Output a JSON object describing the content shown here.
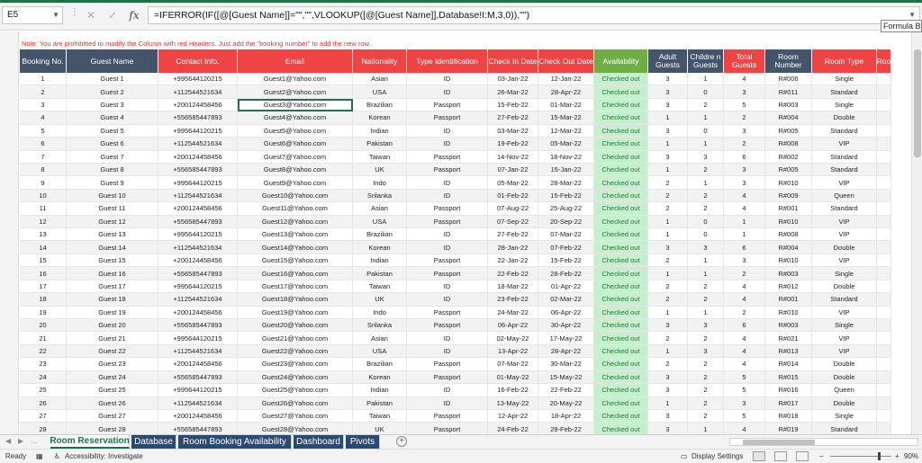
{
  "formula_bar": {
    "name_box": "E5",
    "formula": "=IFERROR(IF([@[Guest Name]]=\"\",\"\",VLOOKUP([@[Guest Name]],Database!I:M,3,0)),\"\")",
    "tooltip": "Formula Bar"
  },
  "note": "Note: You are prohibitted to modify the Column with red Headers. Just add the \"booking number\" to add the new row.",
  "table": {
    "columns": [
      {
        "label": "Booking No.",
        "style": "dark"
      },
      {
        "label": "Guest Name",
        "style": "dark"
      },
      {
        "label": "Contact Info.",
        "style": "red"
      },
      {
        "label": "Email",
        "style": "red"
      },
      {
        "label": "Nationality",
        "style": "red"
      },
      {
        "label": "Type Identification",
        "style": "red"
      },
      {
        "label": "Check In Date",
        "style": "red"
      },
      {
        "label": "Check Out Date",
        "style": "red"
      },
      {
        "label": "Availability",
        "style": "green"
      },
      {
        "label": "Adult Guests",
        "style": "dark"
      },
      {
        "label": "Childre n Guests",
        "style": "dark"
      },
      {
        "label": "Total Guests",
        "style": "red"
      },
      {
        "label": "Room Number",
        "style": "dark"
      },
      {
        "label": "Room Type",
        "style": "red"
      },
      {
        "label": "Roo",
        "style": "red"
      }
    ],
    "rows": [
      [
        "1",
        "Guest 1",
        "+995644120215",
        "Guest1@Yahoo.com",
        "Asian",
        "ID",
        "03-Jan-22",
        "12-Jan-22",
        "Checked out",
        "3",
        "1",
        "4",
        "R#006",
        "Single"
      ],
      [
        "2",
        "Guest 2",
        "+112544521634",
        "Guest2@Yahoo.com",
        "USA",
        "ID",
        "26-Mar-22",
        "28-Apr-22",
        "Checked out",
        "3",
        "0",
        "3",
        "R#011",
        "Standard"
      ],
      [
        "3",
        "Guest 3",
        "+200124458456",
        "Guest3@Yahoo.com",
        "Brazilian",
        "Passport",
        "15-Feb-22",
        "01-Mar-22",
        "Checked out",
        "3",
        "2",
        "5",
        "R#003",
        "Single"
      ],
      [
        "4",
        "Guest 4",
        "+556585447893",
        "Guest4@Yahoo.com",
        "Korean",
        "Passport",
        "27-Feb-22",
        "15-Mar-22",
        "Checked out",
        "1",
        "1",
        "2",
        "R#004",
        "Double"
      ],
      [
        "5",
        "Guest 5",
        "+995644120215",
        "Guest5@Yahoo.com",
        "Indian",
        "ID",
        "03-Mar-22",
        "12-Mar-22",
        "Checked out",
        "3",
        "0",
        "3",
        "R#005",
        "Standard"
      ],
      [
        "6",
        "Guest 6",
        "+112544521634",
        "Guest6@Yahoo.com",
        "Pakistan",
        "ID",
        "19-Feb-22",
        "05-Mar-22",
        "Checked out",
        "1",
        "1",
        "2",
        "R#008",
        "VIP"
      ],
      [
        "7",
        "Guest 7",
        "+200124458456",
        "Guest7@Yahoo.com",
        "Taiwan",
        "Passport",
        "14-Nov-22",
        "18-Nov-22",
        "Checked out",
        "3",
        "3",
        "6",
        "R#002",
        "Standard"
      ],
      [
        "8",
        "Guest 8",
        "+556585447893",
        "Guest8@Yahoo.com",
        "UK",
        "Passport",
        "07-Jan-22",
        "15-Jan-22",
        "Checked out",
        "1",
        "2",
        "3",
        "R#005",
        "Standard"
      ],
      [
        "9",
        "Guest 9",
        "+995644120215",
        "Guest9@Yahoo.com",
        "Indo",
        "ID",
        "05-Mar-22",
        "28-Mar-22",
        "Checked out",
        "2",
        "1",
        "3",
        "R#010",
        "VIP"
      ],
      [
        "10",
        "Guest 10",
        "+112544521634",
        "Guest10@Yahoo.com",
        "Srilanka",
        "ID",
        "01-Feb-22",
        "15-Feb-22",
        "Checked out",
        "2",
        "2",
        "4",
        "R#009",
        "Queen"
      ],
      [
        "11",
        "Guest 11",
        "+200124458456",
        "Guest11@Yahoo.com",
        "Asian",
        "Passport",
        "07-Aug-22",
        "25-Aug-22",
        "Checked out",
        "2",
        "2",
        "4",
        "R#001",
        "Standard"
      ],
      [
        "12",
        "Guest 12",
        "+556585447893",
        "Guest12@Yahoo.com",
        "USA",
        "Passport",
        "07-Sep-22",
        "20-Sep-22",
        "Checked out",
        "1",
        "0",
        "1",
        "R#010",
        "VIP"
      ],
      [
        "13",
        "Guest 13",
        "+995644120215",
        "Guest13@Yahoo.com",
        "Brazilian",
        "ID",
        "27-Feb-22",
        "07-Mar-22",
        "Checked out",
        "1",
        "0",
        "1",
        "R#008",
        "VIP"
      ],
      [
        "14",
        "Guest 14",
        "+112544521634",
        "Guest14@Yahoo.com",
        "Korean",
        "ID",
        "28-Jan-22",
        "07-Feb-22",
        "Checked out",
        "3",
        "3",
        "6",
        "R#004",
        "Double"
      ],
      [
        "15",
        "Guest 15",
        "+200124458456",
        "Guest15@Yahoo.com",
        "Indian",
        "Passport",
        "22-Jan-22",
        "15-Feb-22",
        "Checked out",
        "2",
        "1",
        "3",
        "R#010",
        "VIP"
      ],
      [
        "16",
        "Guest 16",
        "+556585447893",
        "Guest16@Yahoo.com",
        "Pakistan",
        "Passport",
        "22-Feb-22",
        "28-Feb-22",
        "Checked out",
        "1",
        "1",
        "2",
        "R#003",
        "Single"
      ],
      [
        "17",
        "Guest 17",
        "+995644120215",
        "Guest17@Yahoo.com",
        "Taiwan",
        "ID",
        "18-Mar-22",
        "01-Apr-22",
        "Checked out",
        "2",
        "2",
        "4",
        "R#012",
        "Double"
      ],
      [
        "18",
        "Guest 18",
        "+112544521634",
        "Guest18@Yahoo.com",
        "UK",
        "ID",
        "23-Feb-22",
        "02-Mar-22",
        "Checked out",
        "2",
        "2",
        "4",
        "R#001",
        "Standard"
      ],
      [
        "19",
        "Guest 19",
        "+200124458456",
        "Guest19@Yahoo.com",
        "Indo",
        "Passport",
        "24-Mar-22",
        "06-Apr-22",
        "Checked out",
        "1",
        "1",
        "2",
        "R#010",
        "VIP"
      ],
      [
        "20",
        "Guest 20",
        "+556585447893",
        "Guest20@Yahoo.com",
        "Srilanka",
        "Passport",
        "06-Apr-22",
        "30-Apr-22",
        "Checked out",
        "3",
        "3",
        "6",
        "R#003",
        "Single"
      ],
      [
        "21",
        "Guest 21",
        "+995644120215",
        "Guest21@Yahoo.com",
        "Asian",
        "ID",
        "02-May-22",
        "17-May-22",
        "Checked out",
        "2",
        "2",
        "4",
        "R#021",
        "VIP"
      ],
      [
        "22",
        "Guest 22",
        "+112544521634",
        "Guest22@Yahoo.com",
        "USA",
        "ID",
        "13-Apr-22",
        "28-Apr-22",
        "Checked out",
        "1",
        "3",
        "4",
        "R#013",
        "VIP"
      ],
      [
        "23",
        "Guest 23",
        "+200124458456",
        "Guest23@Yahoo.com",
        "Brazilian",
        "Passport",
        "07-Mar-22",
        "30-Mar-22",
        "Checked out",
        "2",
        "2",
        "4",
        "R#014",
        "Double"
      ],
      [
        "24",
        "Guest 24",
        "+556585447893",
        "Guest24@Yahoo.com",
        "Korean",
        "Passport",
        "01-May-22",
        "15-May-22",
        "Checked out",
        "3",
        "2",
        "5",
        "R#015",
        "Double"
      ],
      [
        "25",
        "Guest 25",
        "+995644120215",
        "Guest25@Yahoo.com",
        "Indian",
        "ID",
        "16-Feb-22",
        "22-Feb-22",
        "Checked out",
        "3",
        "2",
        "5",
        "R#016",
        "Queen"
      ],
      [
        "26",
        "Guest 26",
        "+112544521634",
        "Guest26@Yahoo.com",
        "Pakistan",
        "ID",
        "13-May-22",
        "20-May-22",
        "Checked out",
        "1",
        "2",
        "3",
        "R#017",
        "Double"
      ],
      [
        "27",
        "Guest 27",
        "+200124458456",
        "Guest27@Yahoo.com",
        "Taiwan",
        "Passport",
        "12-Apr-22",
        "18-Apr-22",
        "Checked out",
        "3",
        "2",
        "5",
        "R#018",
        "Single"
      ],
      [
        "28",
        "Guest 28",
        "+556585447893",
        "Guest28@Yahoo.com",
        "UK",
        "Passport",
        "24-Feb-22",
        "28-Feb-22",
        "Checked out",
        "3",
        "1",
        "4",
        "R#019",
        "Standard"
      ]
    ],
    "selected_cell": {
      "row": 2,
      "col": 3
    }
  },
  "tabs": [
    {
      "label": "Room Reservation",
      "active": true
    },
    {
      "label": "Database",
      "active": false
    },
    {
      "label": "Room Booking Availability",
      "active": false
    },
    {
      "label": "Dashboard",
      "active": false
    },
    {
      "label": "Pivots",
      "active": false
    }
  ],
  "status_bar": {
    "ready": "Ready",
    "accessibility": "Accessibility: Investigate",
    "display_settings": "Display Settings",
    "zoom": "90%"
  },
  "colors": {
    "header_dark": "#44546a",
    "header_red": "#ef4444",
    "header_green": "#70ad47",
    "availability_fill": "#c6efce",
    "note_red": "#e03030",
    "excel_green": "#1e7145"
  }
}
